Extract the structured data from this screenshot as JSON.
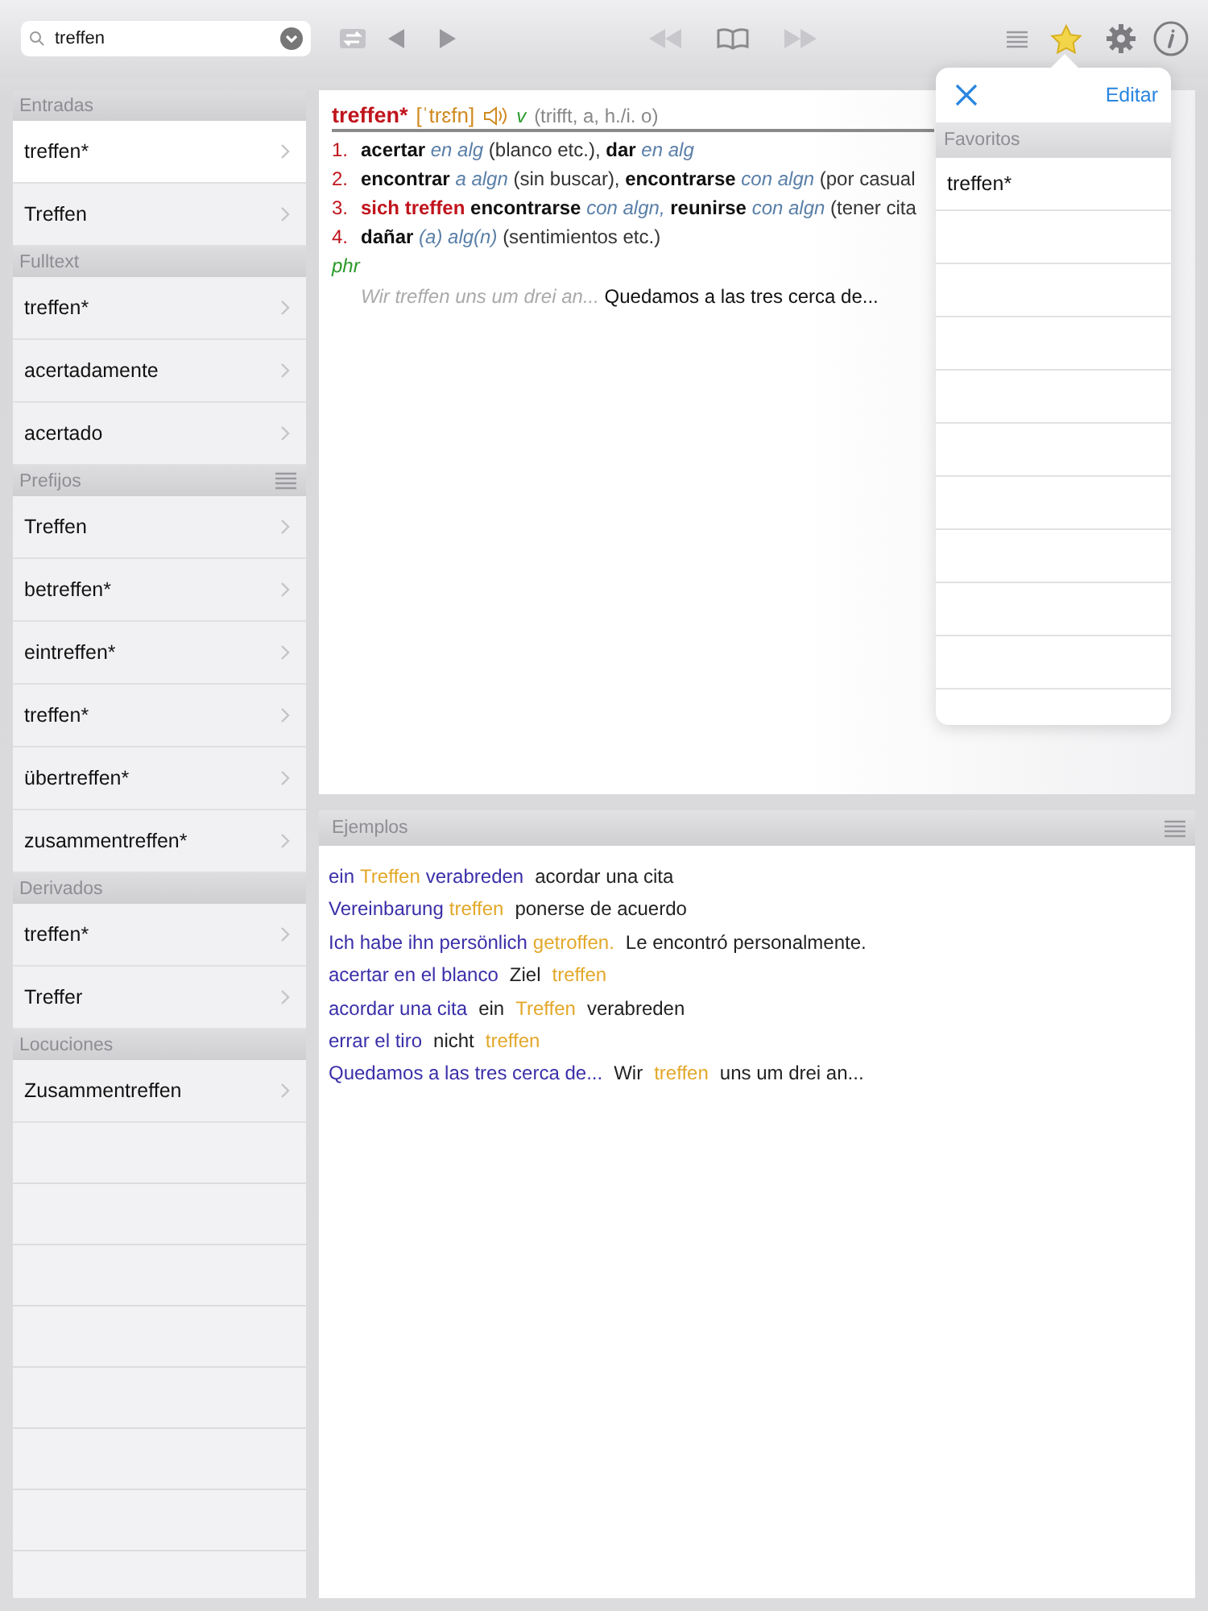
{
  "search": {
    "value": "treffen"
  },
  "sidebar": {
    "sections": [
      {
        "title": "Entradas",
        "menu": false,
        "items": [
          {
            "label": "treffen*",
            "selected": true
          },
          {
            "label": "Treffen",
            "selected": false
          }
        ]
      },
      {
        "title": "Fulltext",
        "menu": false,
        "items": [
          {
            "label": "treffen*",
            "selected": false
          },
          {
            "label": "acertadamente",
            "selected": false
          },
          {
            "label": "acertado",
            "selected": false
          }
        ]
      },
      {
        "title": "Prefijos",
        "menu": true,
        "items": [
          {
            "label": "Treffen",
            "selected": false
          },
          {
            "label": "betreffen*",
            "selected": false
          },
          {
            "label": "eintreffen*",
            "selected": false
          },
          {
            "label": "treffen*",
            "selected": false
          },
          {
            "label": "übertreffen*",
            "selected": false
          },
          {
            "label": "zusammentreffen*",
            "selected": false
          }
        ]
      },
      {
        "title": "Derivados",
        "menu": false,
        "items": [
          {
            "label": "treffen*",
            "selected": false
          },
          {
            "label": "Treffer",
            "selected": false
          }
        ]
      },
      {
        "title": "Locuciones",
        "menu": false,
        "items": [
          {
            "label": "Zusammentreffen",
            "selected": false
          }
        ]
      }
    ]
  },
  "entry": {
    "headword": "treffen*",
    "pronunciation": "[ˈtrɛfn]",
    "pos": "v",
    "forms": "(trifft, a, h./i. o)",
    "senses": [
      {
        "number": "1.",
        "parts": [
          {
            "kind": "b",
            "text": "acertar"
          },
          {
            "kind": "i",
            "text": "en alg"
          },
          {
            "kind": "t",
            "text": "(blanco etc.),"
          },
          {
            "kind": "b",
            "text": "dar"
          },
          {
            "kind": "i",
            "text": "en alg"
          }
        ]
      },
      {
        "number": "2.",
        "parts": [
          {
            "kind": "b",
            "text": "encontrar"
          },
          {
            "kind": "i",
            "text": "a algn"
          },
          {
            "kind": "t",
            "text": "(sin buscar),"
          },
          {
            "kind": "b",
            "text": "encontrarse"
          },
          {
            "kind": "i",
            "text": "con algn"
          },
          {
            "kind": "t",
            "text": "(por casual"
          }
        ]
      },
      {
        "number": "3.",
        "parts": [
          {
            "kind": "r",
            "text": "sich treffen"
          },
          {
            "kind": "b",
            "text": "encontrarse"
          },
          {
            "kind": "i",
            "text": "con algn,"
          },
          {
            "kind": "b",
            "text": "reunirse"
          },
          {
            "kind": "i",
            "text": "con algn"
          },
          {
            "kind": "t",
            "text": "(tener cita"
          }
        ]
      },
      {
        "number": "4.",
        "parts": [
          {
            "kind": "b",
            "text": "dañar"
          },
          {
            "kind": "i",
            "text": "(a) alg(n)"
          },
          {
            "kind": "t",
            "text": "(sentimientos etc.)"
          }
        ]
      }
    ],
    "phrase_label": "phr",
    "phrase": {
      "source": "Wir treffen uns um drei an...",
      "target": "Quedamos a las tres cerca de..."
    }
  },
  "examples": {
    "title": "Ejemplos",
    "lines": [
      [
        {
          "kind": "de",
          "text": "ein"
        },
        {
          "kind": "hl",
          "text": "Treffen"
        },
        {
          "kind": "de",
          "text": "verabreden"
        },
        {
          "kind": "es",
          "text": "acordar una cita"
        }
      ],
      [
        {
          "kind": "de",
          "text": "Vereinbarung"
        },
        {
          "kind": "hl",
          "text": "treffen"
        },
        {
          "kind": "es",
          "text": "ponerse de acuerdo"
        }
      ],
      [
        {
          "kind": "de",
          "text": "Ich habe ihn persönlich"
        },
        {
          "kind": "hl",
          "text": "getroffen."
        },
        {
          "kind": "es",
          "text": "Le encontró personalmente."
        }
      ],
      [
        {
          "kind": "de",
          "text": "acertar en el blanco"
        },
        {
          "kind": "es",
          "text": "Ziel"
        },
        {
          "kind": "hl",
          "text": "treffen"
        }
      ],
      [
        {
          "kind": "de",
          "text": "acordar una cita"
        },
        {
          "kind": "es",
          "text": "ein"
        },
        {
          "kind": "hl",
          "text": "Treffen"
        },
        {
          "kind": "es",
          "text": "verabreden"
        }
      ],
      [
        {
          "kind": "de",
          "text": "errar el tiro"
        },
        {
          "kind": "es",
          "text": "nicht"
        },
        {
          "kind": "hl",
          "text": "treffen"
        }
      ],
      [
        {
          "kind": "de",
          "text": "Quedamos a las tres cerca de..."
        },
        {
          "kind": "es",
          "text": "Wir"
        },
        {
          "kind": "hl",
          "text": "treffen"
        },
        {
          "kind": "es",
          "text": "uns um drei an..."
        }
      ]
    ]
  },
  "favorites_popover": {
    "edit": "Editar",
    "section": "Favoritos",
    "items": [
      "treffen*"
    ]
  }
}
